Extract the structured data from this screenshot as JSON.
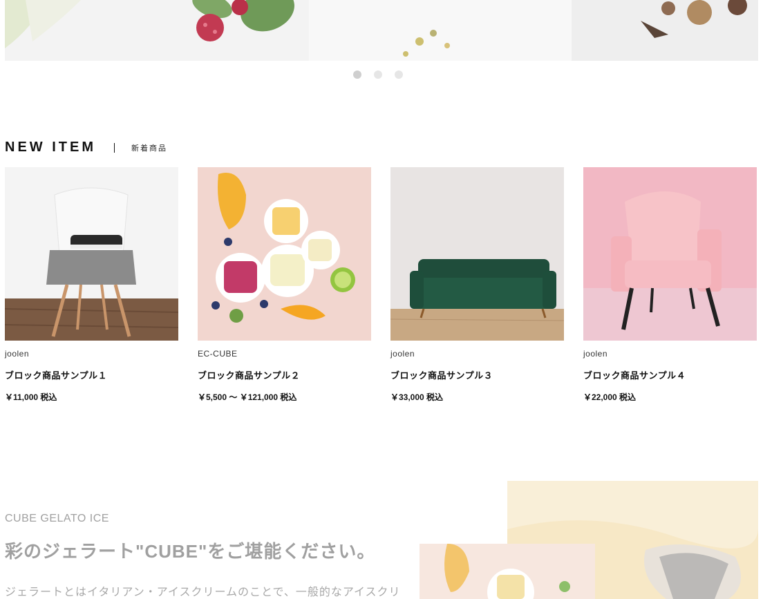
{
  "slider": {
    "dots": [
      {
        "name": "slide-dot-1",
        "active": true
      },
      {
        "name": "slide-dot-2",
        "active": false
      },
      {
        "name": "slide-dot-3",
        "active": false
      }
    ]
  },
  "new_item": {
    "title": "NEW ITEM",
    "subtitle": "新着商品",
    "products": [
      {
        "maker": "joolen",
        "name": "ブロック商品サンプル１",
        "price": "￥11,000 税込"
      },
      {
        "maker": "EC-CUBE",
        "name": "ブロック商品サンプル２",
        "price": "￥5,500 ～ ￥121,000 税込"
      },
      {
        "maker": "joolen",
        "name": "ブロック商品サンプル３",
        "price": "￥33,000 税込"
      },
      {
        "maker": "joolen",
        "name": "ブロック商品サンプル４",
        "price": "￥22,000 税込"
      }
    ]
  },
  "about": {
    "label_en": "CUBE GELATO ICE",
    "title": "彩のジェラート\"CUBE\"をご堪能ください。",
    "text": "ジェラートとはイタリアン・アイスクリームのことで、一般的なアイスクリ"
  },
  "colors": {
    "dot_active": "#cfcfcf",
    "dot_inactive": "#e6e6e6",
    "muted_text": "#a0a0a0"
  }
}
